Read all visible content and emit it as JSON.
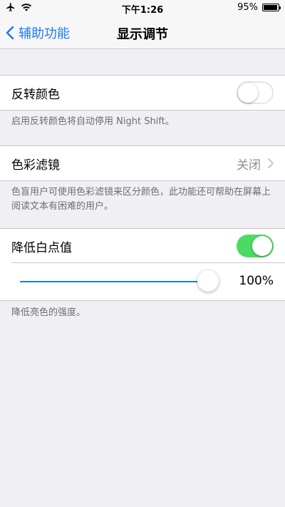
{
  "status": {
    "time": "下午1:26",
    "battery": "95%",
    "battery_level": 0.95
  },
  "nav": {
    "back_label": "辅助功能",
    "title": "显示调节"
  },
  "invert": {
    "label": "反转颜色",
    "on": false,
    "footer": "启用反转颜色将自动停用 Night Shift。"
  },
  "filters": {
    "label": "色彩滤镜",
    "value": "关闭",
    "footer": "色盲用户可使用色彩滤镜来区分颜色，此功能还可帮助在屏幕上阅读文本有困难的用户。"
  },
  "white_point": {
    "label": "降低白点值",
    "on": true,
    "value_text": "100%",
    "level": 1.0,
    "footer": "降低亮色的强度。"
  },
  "colors": {
    "accent": "#1a7cf5",
    "toggle_on": "#4cd964",
    "background": "#efeff4"
  }
}
